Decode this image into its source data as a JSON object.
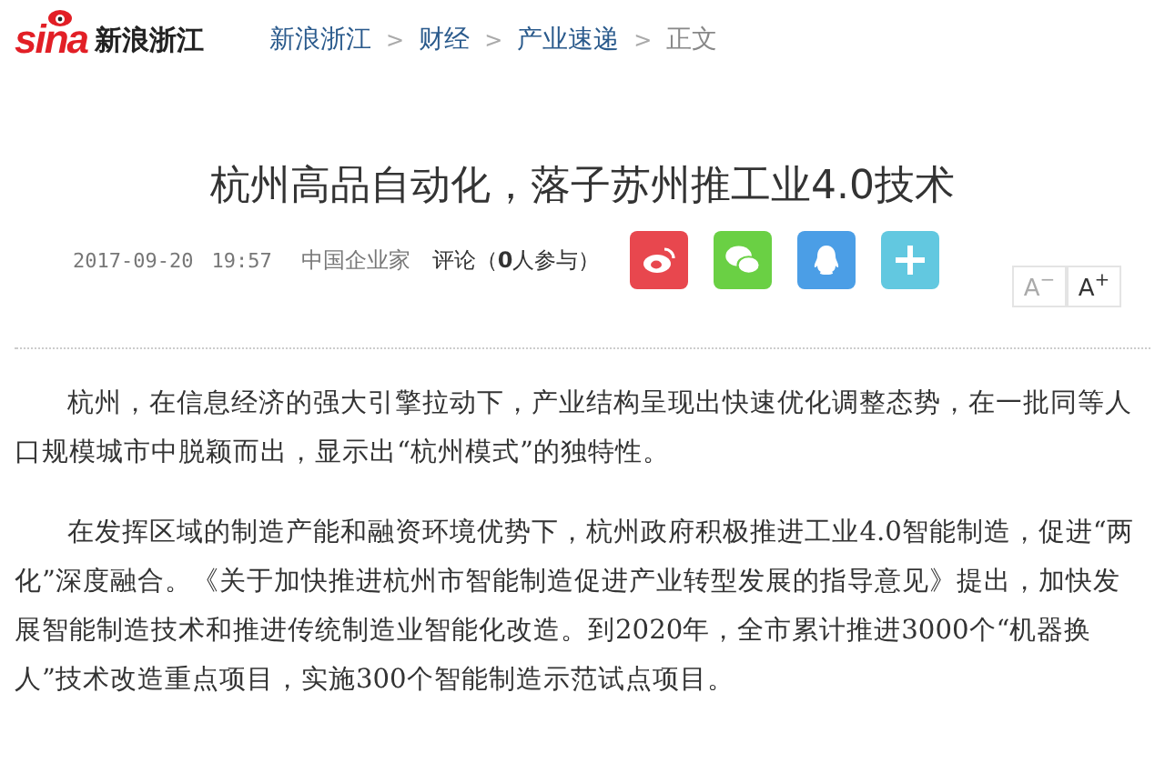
{
  "header": {
    "logo_text": "sina",
    "site_name": "新浪浙江"
  },
  "breadcrumb": [
    {
      "label": "新浪浙江",
      "kind": "link"
    },
    {
      "label": ">",
      "kind": "sep"
    },
    {
      "label": "财经",
      "kind": "link"
    },
    {
      "label": ">",
      "kind": "sep"
    },
    {
      "label": "产业速递",
      "kind": "link"
    },
    {
      "label": ">",
      "kind": "sep"
    },
    {
      "label": "正文",
      "kind": "current"
    }
  ],
  "article": {
    "title": "杭州高品自动化，落子苏州推工业4.0技术",
    "date": "2017-09-20",
    "time": "19:57",
    "source": "中国企业家",
    "comments": "评论（**0**人参与）",
    "share": [
      {
        "kind": "weibo",
        "color": "#e8474e"
      },
      {
        "kind": "wechat",
        "color": "#6ad044"
      },
      {
        "kind": "qq",
        "color": "#4b9ee6"
      },
      {
        "kind": "more",
        "color": "#62c8e0"
      }
    ],
    "font_buttons": [
      {
        "letter": "A",
        "sign": "−",
        "kind": "smaller"
      },
      {
        "letter": "A",
        "sign": "+",
        "kind": "larger"
      }
    ],
    "paragraphs": [
      "杭州，在信息经济的强大引擎拉动下，产业结构呈现出快速优化调整态势，在一批同等人口规模城市中脱颖而出，显示出“杭州模式”的独特性。",
      "在发挥区域的制造产能和融资环境优势下，杭州政府积极推进工业4.0智能制造，促进“两化”深度融合。《关于加快推进杭州市智能制造促进产业转型发展的指导意见》提出，加快发展智能制造技术和推进传统制造业智能化改造。到2020年，全市累计推进3000个“机器换人”技术改造重点项目，实施300个智能制造示范试点项目。"
    ]
  }
}
